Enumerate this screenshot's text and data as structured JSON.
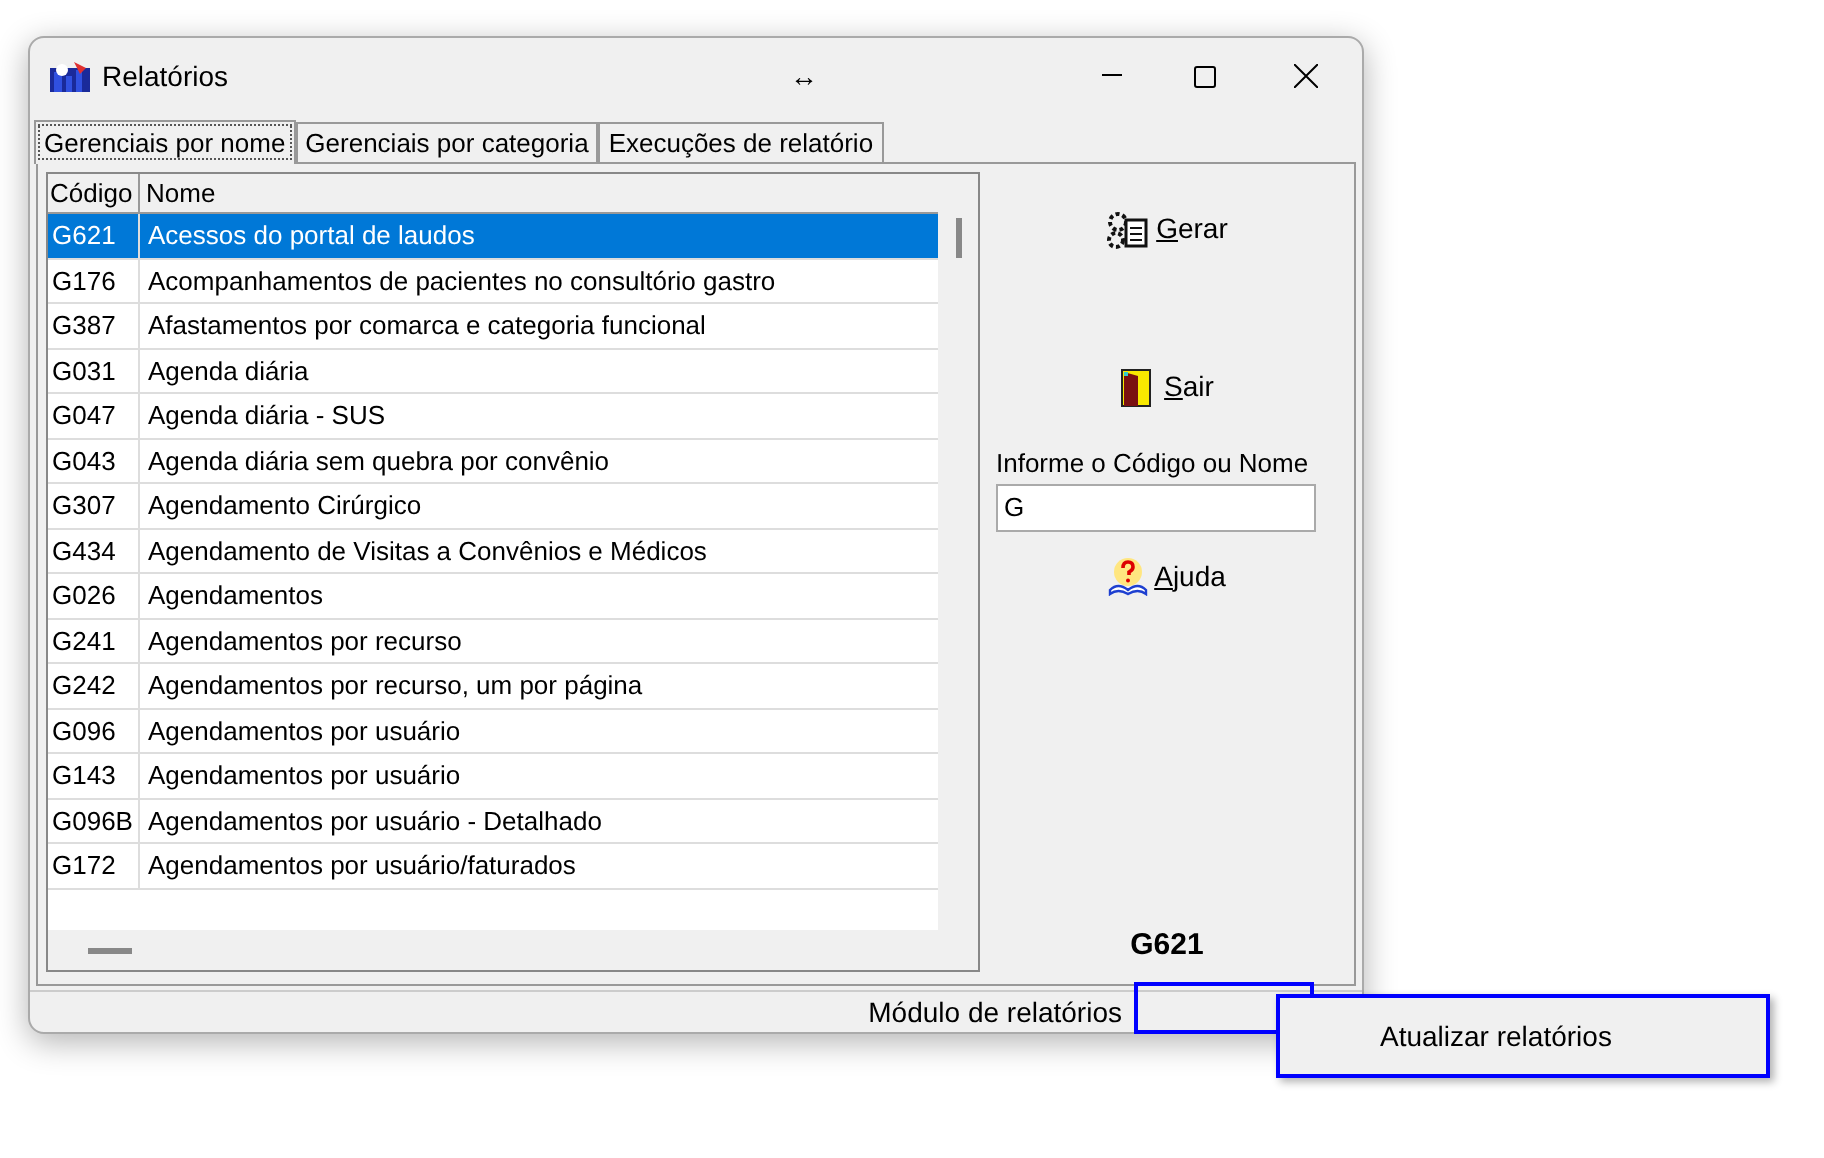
{
  "window": {
    "title": "Relatórios",
    "resize_glyph": "↔"
  },
  "tabs": [
    {
      "label": "Gerenciais por nome",
      "selected": true
    },
    {
      "label": "Gerenciais por categoria",
      "selected": false
    },
    {
      "label": "Execuções de relatório",
      "selected": false
    }
  ],
  "table": {
    "columns": [
      "Código",
      "Nome"
    ],
    "rows": [
      {
        "code": "G621",
        "name": "Acessos do portal de laudos",
        "selected": true
      },
      {
        "code": "G176",
        "name": "Acompanhamentos de pacientes no consultório gastro",
        "selected": false
      },
      {
        "code": "G387",
        "name": "Afastamentos por comarca e categoria funcional",
        "selected": false
      },
      {
        "code": "G031",
        "name": "Agenda diária",
        "selected": false
      },
      {
        "code": "G047",
        "name": "Agenda diária - SUS",
        "selected": false
      },
      {
        "code": "G043",
        "name": "Agenda diária sem quebra por convênio",
        "selected": false
      },
      {
        "code": "G307",
        "name": "Agendamento Cirúrgico",
        "selected": false
      },
      {
        "code": "G434",
        "name": "Agendamento de Visitas a Convênios e Médicos",
        "selected": false
      },
      {
        "code": "G026",
        "name": "Agendamentos",
        "selected": false
      },
      {
        "code": "G241",
        "name": "Agendamentos por recurso",
        "selected": false
      },
      {
        "code": "G242",
        "name": "Agendamentos por recurso, um por página",
        "selected": false
      },
      {
        "code": "G096",
        "name": "Agendamentos por usuário",
        "selected": false
      },
      {
        "code": "G143",
        "name": "Agendamentos por usuário",
        "selected": false
      },
      {
        "code": "G096B",
        "name": "Agendamentos por usuário - Detalhado",
        "selected": false
      },
      {
        "code": "G172",
        "name": "Agendamentos por usuário/faturados",
        "selected": false
      }
    ]
  },
  "actions": [
    {
      "kind": "generate",
      "label": "Gerar"
    },
    {
      "kind": "exit",
      "label": "Sair"
    }
  ],
  "search": {
    "label": "Informe o Código ou Nome",
    "value": "G"
  },
  "help": {
    "label": "Ajuda"
  },
  "selected_code": "G621",
  "status_bar": {
    "module": "Módulo de relatórios"
  },
  "context_menu": {
    "items": [
      "Atualizar relatórios"
    ]
  }
}
